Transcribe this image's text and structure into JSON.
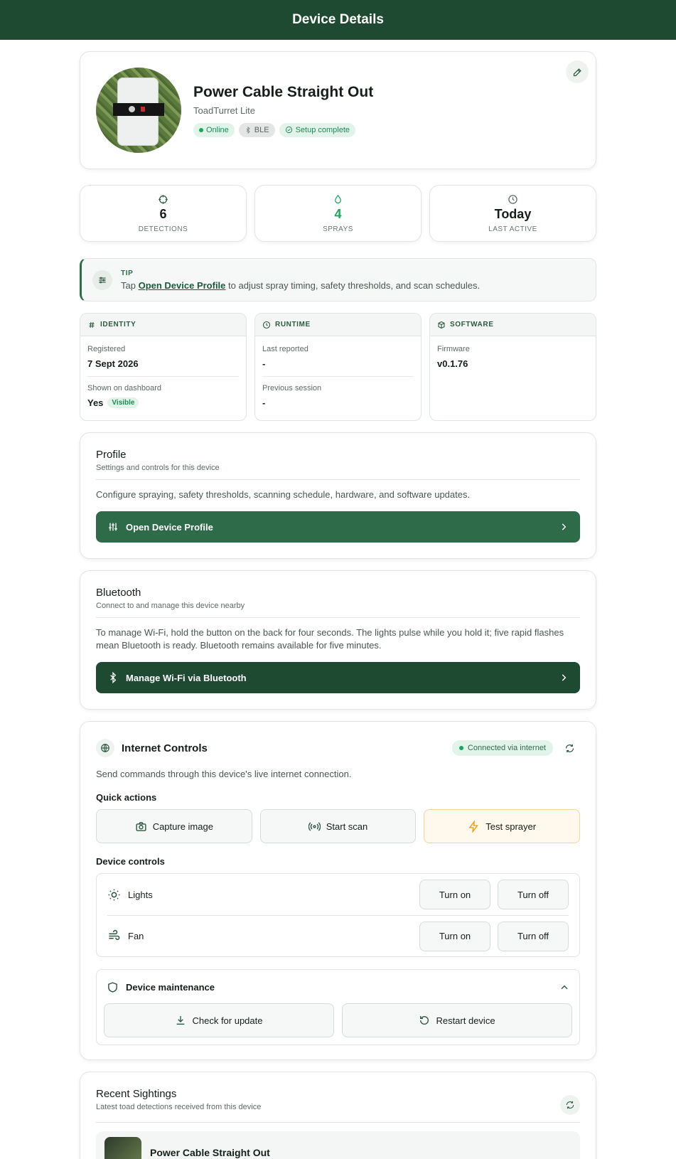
{
  "header": {
    "title": "Device Details"
  },
  "device": {
    "name": "Power Cable Straight Out",
    "model": "ToadTurret Lite",
    "badges": {
      "online": "Online",
      "ble": "BLE",
      "setup": "Setup complete"
    }
  },
  "stats": [
    {
      "value": "6",
      "label": "DETECTIONS",
      "icon": "crosshair-icon"
    },
    {
      "value": "4",
      "label": "SPRAYS",
      "icon": "droplet-icon"
    },
    {
      "value": "Today",
      "label": "LAST ACTIVE",
      "icon": "clock-icon"
    }
  ],
  "tip": {
    "label": "TIP",
    "prefix": "Tap ",
    "link": "Open Device Profile",
    "suffix": " to adjust spray timing, safety thresholds, and scan schedules."
  },
  "identity": {
    "title": "IDENTITY",
    "registered_label": "Registered",
    "registered_value": "7 Sept 2026",
    "dashboard_label": "Shown on dashboard",
    "dashboard_value": "Yes",
    "visible_badge": "Visible"
  },
  "runtime": {
    "title": "RUNTIME",
    "last_reported_label": "Last reported",
    "last_reported_value": "-",
    "previous_session_label": "Previous session",
    "previous_session_value": "-"
  },
  "software": {
    "title": "SOFTWARE",
    "firmware_label": "Firmware",
    "firmware_value": "v0.1.76"
  },
  "profile": {
    "title": "Profile",
    "subtitle": "Settings and controls for this device",
    "body": "Configure spraying, safety thresholds, scanning schedule, hardware, and software updates.",
    "button": "Open Device Profile"
  },
  "bluetooth": {
    "title": "Bluetooth",
    "subtitle": "Connect to and manage this device nearby",
    "body": "To manage Wi-Fi, hold the button on the back for four seconds. The lights pulse while you hold it; five rapid flashes mean Bluetooth is ready. Bluetooth remains available for five minutes.",
    "button": "Manage Wi-Fi via Bluetooth"
  },
  "internet": {
    "title": "Internet Controls",
    "status": "Connected via internet",
    "description": "Send commands through this device's live internet connection.",
    "quick_actions_title": "Quick actions",
    "quick_actions": [
      "Capture image",
      "Start scan",
      "Test sprayer"
    ],
    "device_controls_title": "Device controls",
    "controls": [
      {
        "name": "Lights",
        "on": "Turn on",
        "off": "Turn off"
      },
      {
        "name": "Fan",
        "on": "Turn on",
        "off": "Turn off"
      }
    ],
    "maintenance_title": "Device maintenance",
    "maintenance_actions": [
      "Check for update",
      "Restart device"
    ]
  },
  "recent": {
    "title": "Recent Sightings",
    "subtitle": "Latest toad detections received from this device",
    "items": [
      {
        "name": "Power Cable Straight Out"
      }
    ]
  },
  "colors": {
    "brand": "#1e4a32",
    "accent": "#2d6b49",
    "success": "#17a85a",
    "warning": "#f0a020"
  }
}
